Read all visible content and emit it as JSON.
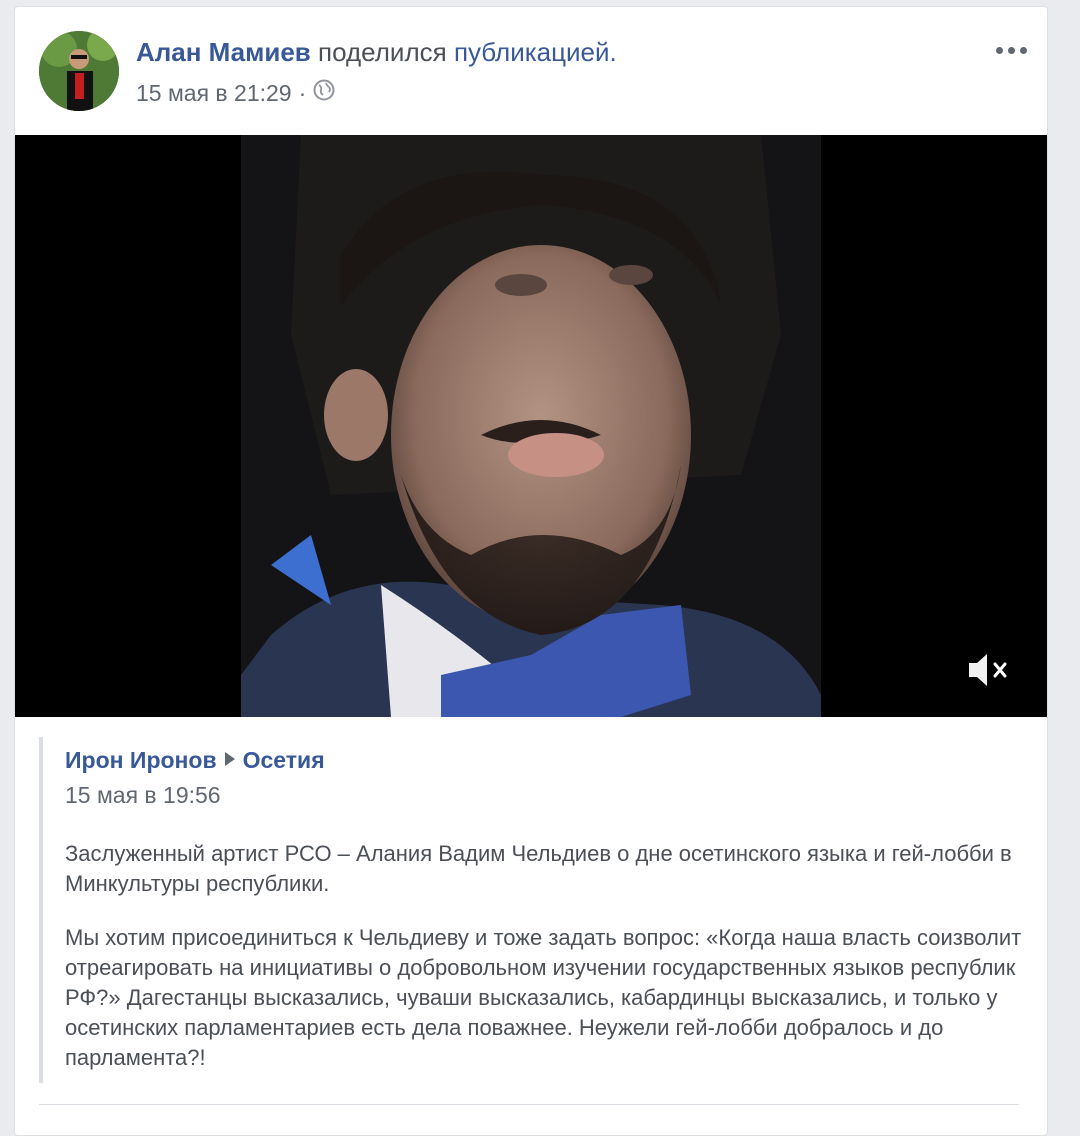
{
  "post": {
    "author": "Алан Мамиев",
    "action": "поделился",
    "object": "публикацией.",
    "timestamp": "15 мая в 21:29",
    "separator": "·",
    "privacy_icon": "globe-icon",
    "more_icon": "more-options-icon"
  },
  "video": {
    "mute_icon": "muted-speaker-icon"
  },
  "shared": {
    "author": "Ирон Иронов",
    "arrow_icon": "triangle-right-icon",
    "group": "Осетия",
    "timestamp": "15 мая в 19:56",
    "paragraph1": "Заслуженный артист РСО – Алания Вадим Чельдиев о дне осетинского языка и гей-лобби в Минкультуры республики.",
    "paragraph2": "Мы хотим присоединиться к Чельдиеву и тоже задать вопрос: «Когда наша власть соизволит отреагировать на инициативы о добровольном изучении государственных языков республик РФ?» Дагестанцы высказались, чуваши высказались, кабардинцы высказались, и только у осетинских парламентариев есть дела поважнее. Неужели гей-лобби добралось и до парламента?!"
  },
  "colors": {
    "link": "#385898",
    "text": "#4b4f56",
    "meta": "#616770",
    "background": "#e9ebee"
  }
}
